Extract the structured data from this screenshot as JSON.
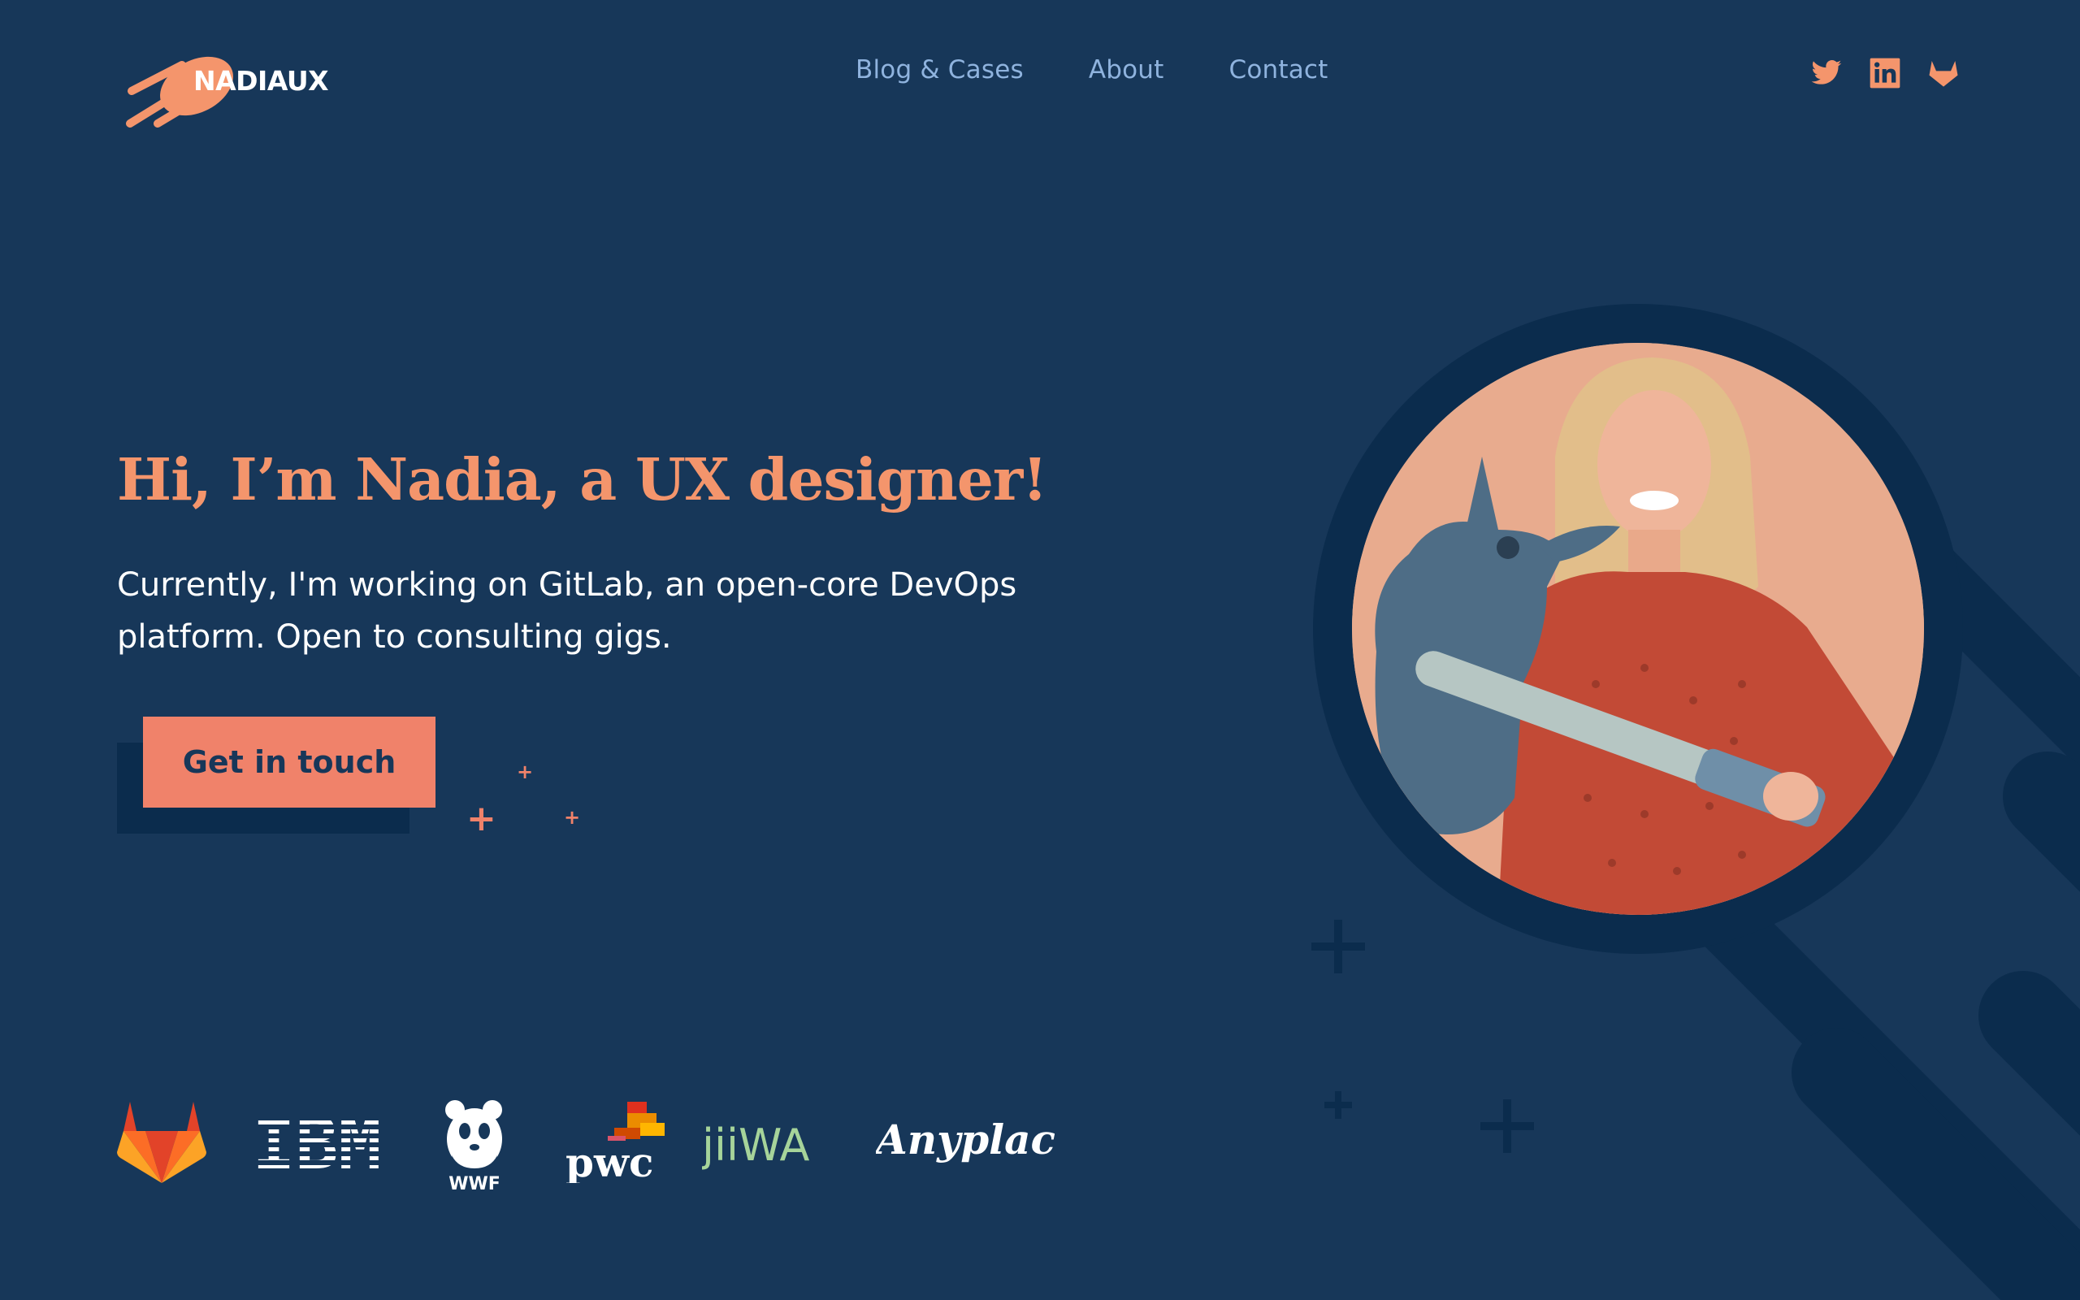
{
  "brand": {
    "name": "NADIAUX"
  },
  "nav": {
    "items": [
      {
        "label": "Blog & Cases"
      },
      {
        "label": "About"
      },
      {
        "label": "Contact"
      }
    ]
  },
  "social": {
    "icons": [
      "twitter-icon",
      "linkedin-icon",
      "gitlab-icon"
    ]
  },
  "hero": {
    "title": "Hi, I’m Nadia, a UX designer!",
    "subtitle": "Currently, I'm working on GitLab, an open-core DevOps platform. Open to consulting gigs.",
    "cta_label": "Get in touch"
  },
  "clients": {
    "logos": [
      "gitlab",
      "IBM",
      "WWF",
      "pwc",
      "jiiWA",
      "Anyplace"
    ],
    "ibm_text": "IBM",
    "wwf_text": "WWF",
    "pwc_text": "pwc",
    "jiiwa_text": "jiiWA",
    "anyplace_text": "Anyplace"
  },
  "colors": {
    "background": "#173759",
    "accent": "#f0826a",
    "title": "#f4956c",
    "nav": "#8fb3de",
    "deco": "#0b2c4d"
  }
}
